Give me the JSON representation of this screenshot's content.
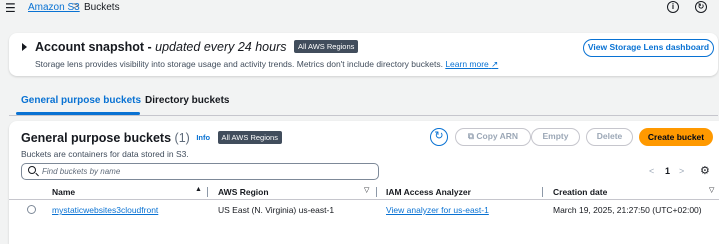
{
  "breadcrumb": {
    "service": "Amazon S3",
    "separator": ">",
    "current": "Buckets"
  },
  "top_icons": [
    "info-icon",
    "notifications-icon"
  ],
  "snapshot": {
    "title": "Account snapshot - ",
    "subtitle": "updated every 24 hours",
    "region_badge": "All AWS Regions",
    "description": "Storage lens provides visibility into storage usage and activity trends. Metrics don't include directory buckets.",
    "learn_more": "Learn more",
    "dashboard_button": "View Storage Lens dashboard"
  },
  "tabs": [
    {
      "label": "General purpose buckets",
      "active": true
    },
    {
      "label": "Directory buckets",
      "active": false
    }
  ],
  "buckets_panel": {
    "title": "General purpose buckets",
    "count": "(1)",
    "info": "Info",
    "region_badge": "All AWS Regions",
    "description": "Buckets are containers for data stored in S3.",
    "buttons": {
      "copy_arn": "Copy ARN",
      "empty": "Empty",
      "delete": "Delete",
      "create": "Create bucket"
    },
    "search_placeholder": "Find buckets by name",
    "pagination": {
      "prev": "<",
      "page": "1",
      "next": ">"
    },
    "columns": [
      "Name",
      "AWS Region",
      "IAM Access Analyzer",
      "Creation date"
    ],
    "rows": [
      {
        "name": "mystaticwebsites3cloudfront",
        "region": "US East (N. Virginia) us-east-1",
        "analyzer": "View analyzer for us-east-1",
        "created": "March 19, 2025, 21:27:50 (UTC+02:00)"
      }
    ]
  },
  "colors": {
    "link": "#0972d3",
    "primary_button": "#ff9900",
    "badge": "#414d5c"
  }
}
